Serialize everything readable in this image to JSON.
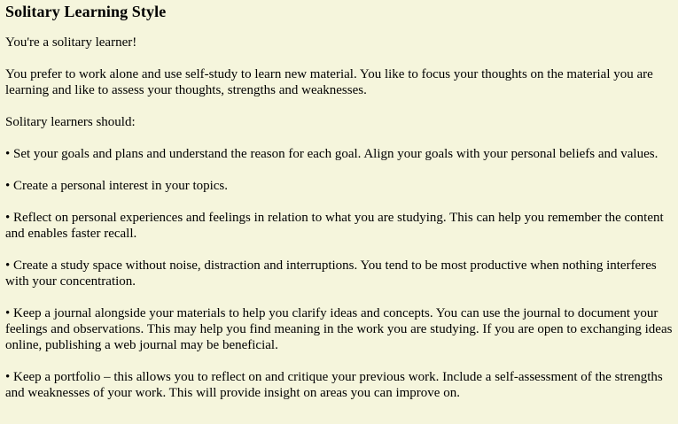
{
  "document": {
    "title": "Solitary Learning Style",
    "intro_line": "You're a solitary learner!",
    "description": "You prefer to work alone and use self-study to learn new material. You like to focus your thoughts on the material you are learning and like to assess your thoughts, strengths and weaknesses.",
    "list_heading": "Solitary learners should:",
    "bullet_symbol": "•",
    "bullets": [
      "Set your goals and plans and understand the reason for each goal. Align your goals with your personal beliefs and values.",
      "Create a personal interest in your topics.",
      "Reflect on personal experiences and feelings in relation to what you are studying. This can help you remember the content and enables faster recall.",
      "Create a study space without noise, distraction and interruptions. You tend to be most productive when nothing interferes with your concentration.",
      "Keep a journal alongside your materials to help you clarify ideas and concepts. You can use the journal to document your feelings and observations. This may help you find meaning in the work you are studying. If you are open to exchanging ideas online, publishing a web journal may be beneficial.",
      "Keep a portfolio – this allows you to reflect on and critique your previous work. Include a self-assessment of the strengths and weaknesses of your work. This will provide insight on areas you can improve on."
    ]
  },
  "colors": {
    "background": "#f5f5dc",
    "text": "#000000"
  }
}
